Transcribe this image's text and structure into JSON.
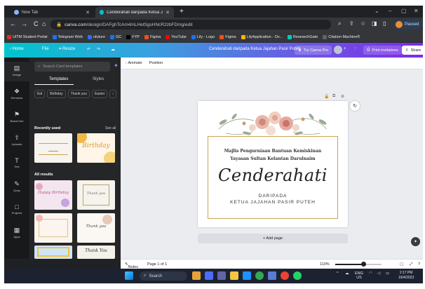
{
  "browser": {
    "tabs": [
      {
        "label": "New Tab",
        "active": false
      },
      {
        "label": "Cenderahati daripada Ketua Jajah",
        "active": true
      }
    ],
    "url_host": "canva.com",
    "url_path": "/design/DAFghTcAm4/nLHetSgsHNcR2zbFDmg/edit",
    "profile_status": "Paused",
    "bookmarks": [
      "UiTM Student Portal",
      "Telegram Web",
      "ufuture",
      "GC",
      "FYP",
      "Figma",
      "YouTube",
      "Lily - Logo",
      "Figma",
      "LilyApplication - Ov...",
      "ResearchGate",
      "Citation Machine®"
    ]
  },
  "canva_header": {
    "home": "Home",
    "file": "File",
    "resize": "Resize",
    "doc_title": "Cenderahati daripada Ketua Jajahan Pasir Puteh",
    "try_pro": "Try Canva Pro",
    "add_people": "+",
    "print_invitations": "Print invitations",
    "share": "Share"
  },
  "rail": [
    {
      "label": "Design",
      "icon": "design-icon",
      "glyph": "▤"
    },
    {
      "label": "Elements",
      "icon": "elements-icon",
      "glyph": "❖"
    },
    {
      "label": "Brand Hub",
      "icon": "brand-icon",
      "glyph": "⚑"
    },
    {
      "label": "Uploads",
      "icon": "upload-icon",
      "glyph": "⇧"
    },
    {
      "label": "Text",
      "icon": "text-icon",
      "glyph": "T"
    },
    {
      "label": "Draw",
      "icon": "draw-icon",
      "glyph": "✎"
    },
    {
      "label": "Projects",
      "icon": "folder-icon",
      "glyph": "□"
    },
    {
      "label": "Apps",
      "icon": "apps-icon",
      "glyph": "▦"
    }
  ],
  "panel": {
    "search_placeholder": "Search Card templates",
    "tabs": [
      "Templates",
      "Styles"
    ],
    "chips": [
      "Eid",
      "Birthday",
      "Thank you",
      "Easter"
    ],
    "chips_more": "›",
    "recently_used": "Recently used",
    "see_all": "See all",
    "recent": [
      "",
      "Birthday"
    ],
    "all_results": "All results",
    "results": [
      "Happy Birthday",
      "Thank you",
      "",
      "Thank you",
      "",
      "Thank You"
    ]
  },
  "editor": {
    "animate": "Animate",
    "position": "Position",
    "card": {
      "line1": "Majlis Pengurniaan Bantuan Kemiskinan",
      "line2": "Yayasan Sultan Kelantan Darulnaim",
      "script": "Cenderahati",
      "line3": "DARIPADA",
      "line4": "KETUA JAJAHAN PASIR PUTEH"
    },
    "add_page": "+ Add page"
  },
  "statusbar": {
    "notes": "Notes",
    "page": "Page 1 of 1",
    "zoom": "110%",
    "zoom_fraction": 0.6
  },
  "taskbar": {
    "search": "Search",
    "lang_top": "ENG",
    "lang_bottom": "US",
    "time": "2:17 PM",
    "date": "19/4/2023"
  },
  "colors": {
    "canva_gradient_start": "#00c4cc",
    "canva_gradient_end": "#7d2ae8",
    "gold": "#c8a552"
  }
}
